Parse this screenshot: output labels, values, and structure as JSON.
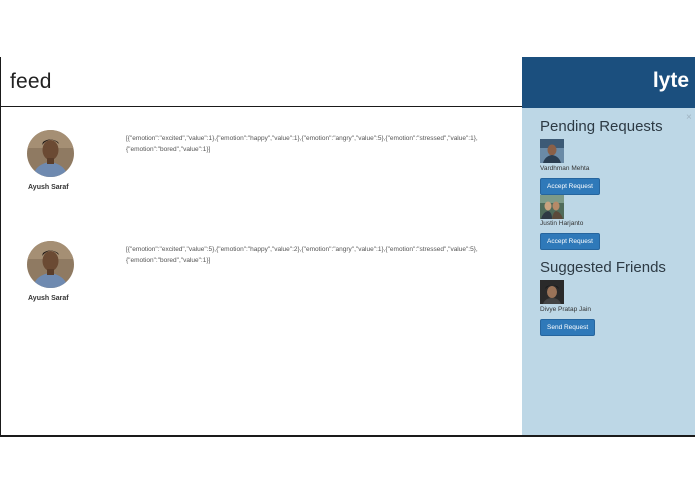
{
  "header": {
    "title": "feed"
  },
  "brand": {
    "name": "lyte"
  },
  "posts": [
    {
      "author": "Ayush Saraf",
      "text": "[{\"emotion\":\"excited\",\"value\":1},{\"emotion\":\"happy\",\"value\":1},{\"emotion\":\"angry\",\"value\":5},{\"emotion\":\"stressed\",\"value\":1},{\"emotion\":\"bored\",\"value\":1}]"
    },
    {
      "author": "Ayush Saraf",
      "text": "[{\"emotion\":\"excited\",\"value\":5},{\"emotion\":\"happy\",\"value\":2},{\"emotion\":\"angry\",\"value\":1},{\"emotion\":\"stressed\",\"value\":5},{\"emotion\":\"bored\",\"value\":1}]"
    }
  ],
  "sidebar": {
    "close_icon": "×",
    "pending": {
      "title": "Pending Requests",
      "items": [
        {
          "name": "Vardhman Mehta",
          "button": "Accept Request"
        },
        {
          "name": "Justin Harjanto",
          "button": "Accept Request"
        }
      ]
    },
    "suggested": {
      "title": "Suggested Friends",
      "items": [
        {
          "name": "Divye Pratap Jain",
          "button": "Send Request"
        }
      ]
    }
  },
  "colors": {
    "brand_bar": "#1b4f7e",
    "sidebar_bg": "#bdd7e6",
    "button_bg": "#2f79b9"
  }
}
